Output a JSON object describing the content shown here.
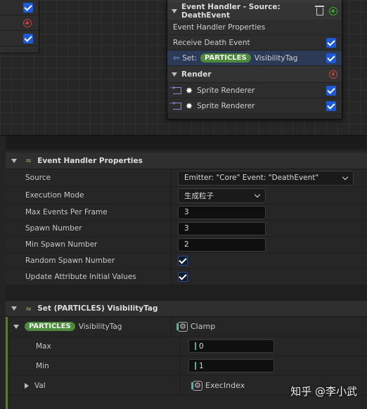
{
  "node": {
    "title": "Event Handler - Source: DeathEvent",
    "rows": {
      "properties": "Event Handler Properties",
      "receive": "Receive Death Event",
      "set_prefix": "Set:",
      "set_pill": "PARTICLES",
      "set_attr": "VisibilityTag"
    },
    "render_header": "Render",
    "renderers": [
      "Sprite Renderer",
      "Sprite Renderer"
    ]
  },
  "details": {
    "section1": {
      "title": "Event Handler Properties",
      "properties": [
        {
          "label": "Source",
          "value": "Emitter: \"Core\" Event: \"DeathEvent\"",
          "kind": "combo"
        },
        {
          "label": "Execution Mode",
          "value": "生成粒子",
          "kind": "combo"
        },
        {
          "label": "Max Events Per Frame",
          "value": "3",
          "kind": "field"
        },
        {
          "label": "Spawn Number",
          "value": "3",
          "kind": "field"
        },
        {
          "label": "Min Spawn Number",
          "value": "2",
          "kind": "field"
        },
        {
          "label": "Random Spawn Number",
          "value": true,
          "kind": "check"
        },
        {
          "label": "Update Attribute Initial Values",
          "value": true,
          "kind": "check"
        }
      ]
    },
    "section2": {
      "title": "Set (PARTICLES) VisibilityTag",
      "param_pill": "PARTICLES",
      "param_name": "VisibilityTag",
      "param_func": "Clamp",
      "inputs": [
        {
          "label": "Max",
          "value": "0"
        },
        {
          "label": "Min",
          "value": "1"
        },
        {
          "label": "Val",
          "value": "ExecIndex"
        }
      ]
    }
  },
  "watermark": "知乎 @李小武",
  "colors": {
    "accent_blue": "#1d5ad8",
    "pill_green": "#4c8a3c",
    "selection": "#2c3a55"
  }
}
